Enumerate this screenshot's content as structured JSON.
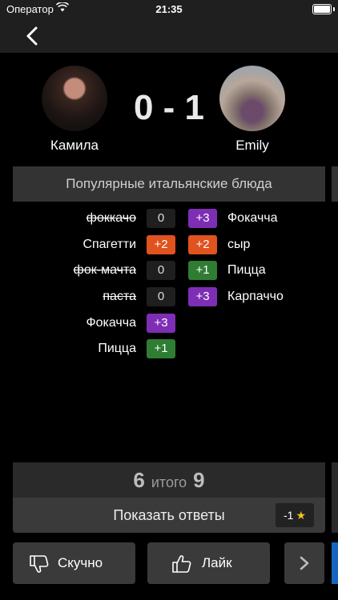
{
  "status_bar": {
    "carrier": "Оператор",
    "time": "21:35"
  },
  "players": {
    "left": {
      "name": "Камила"
    },
    "right": {
      "name": "Emily"
    }
  },
  "score": "0 - 1",
  "card": {
    "title": "Популярные итальянские блюда",
    "rows": [
      {
        "left_word": "фоккачо",
        "left_struck": true,
        "left_badge": "0",
        "left_color": "zero",
        "right_badge": "+3",
        "right_color": "purple",
        "right_word": "Фокачча"
      },
      {
        "left_word": "Спагетти",
        "left_struck": false,
        "left_badge": "+2",
        "left_color": "orange",
        "right_badge": "+2",
        "right_color": "orange",
        "right_word": "сыр"
      },
      {
        "left_word": "фок-мачта",
        "left_struck": true,
        "left_badge": "0",
        "left_color": "zero",
        "right_badge": "+1",
        "right_color": "green",
        "right_word": "Пицца"
      },
      {
        "left_word": "паста",
        "left_struck": true,
        "left_badge": "0",
        "left_color": "zero",
        "right_badge": "+3",
        "right_color": "purple",
        "right_word": "Карпаччо"
      },
      {
        "left_word": "Фокачча",
        "left_struck": false,
        "left_badge": "+3",
        "left_color": "purple"
      },
      {
        "left_word": "Пицца",
        "left_struck": false,
        "left_badge": "+1",
        "left_color": "green"
      }
    ]
  },
  "totals": {
    "left": "6",
    "label": "итого",
    "right": "9"
  },
  "reveal": {
    "label": "Показать ответы",
    "cost": "-1"
  },
  "actions": {
    "dislike_label": "Скучно",
    "like_label": "Лайк"
  },
  "colors": {
    "green": "#2e7d32",
    "orange": "#e0521e",
    "purple": "#7e2eb4",
    "zero": "#1f1f1f",
    "accent_blue": "#1565c0"
  }
}
